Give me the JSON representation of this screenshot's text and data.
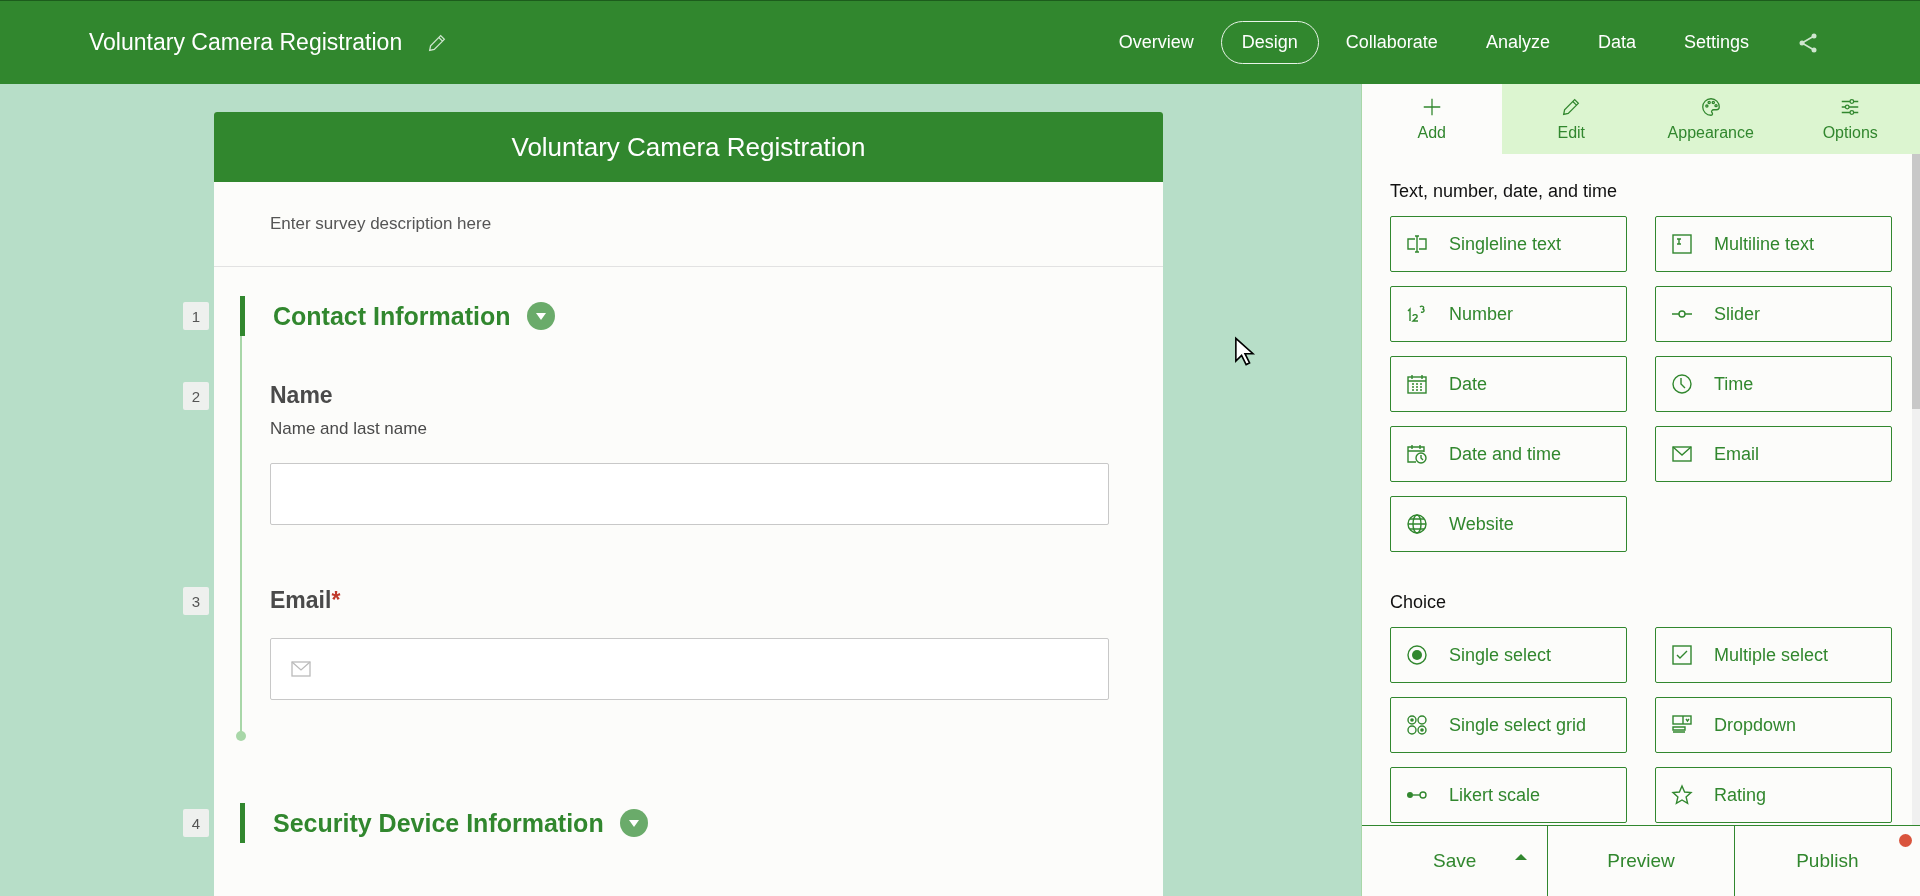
{
  "header": {
    "title": "Voluntary Camera Registration",
    "nav": [
      {
        "label": "Overview",
        "selected": false
      },
      {
        "label": "Design",
        "selected": true
      },
      {
        "label": "Collaborate",
        "selected": false
      },
      {
        "label": "Analyze",
        "selected": false
      },
      {
        "label": "Data",
        "selected": false
      },
      {
        "label": "Settings",
        "selected": false
      }
    ]
  },
  "survey": {
    "title": "Voluntary Camera Registration",
    "description": "Enter survey description here",
    "sections": [
      {
        "number": "1",
        "title": "Contact Information",
        "questions": [
          {
            "number": "2",
            "label": "Name",
            "hint": "Name and last name",
            "kind": "text"
          },
          {
            "number": "3",
            "label": "Email",
            "required_mark": "*",
            "kind": "email"
          }
        ]
      },
      {
        "number": "4",
        "title": "Security Device Information"
      }
    ]
  },
  "panel": {
    "tabs": [
      {
        "label": "Add",
        "kind": "plus",
        "selected": true
      },
      {
        "label": "Edit",
        "kind": "pencil",
        "selected": false
      },
      {
        "label": "Appearance",
        "kind": "palette",
        "selected": false
      },
      {
        "label": "Options",
        "kind": "sliders",
        "selected": false
      }
    ],
    "groups": [
      {
        "title": "Text, number, date, and time",
        "items": [
          {
            "label": "Singleline text",
            "kind": "singleline"
          },
          {
            "label": "Multiline text",
            "kind": "multiline"
          },
          {
            "label": "Number",
            "kind": "number"
          },
          {
            "label": "Slider",
            "kind": "slider"
          },
          {
            "label": "Date",
            "kind": "date"
          },
          {
            "label": "Time",
            "kind": "time"
          },
          {
            "label": "Date and time",
            "kind": "datetime"
          },
          {
            "label": "Email",
            "kind": "email"
          },
          {
            "label": "Website",
            "kind": "website"
          }
        ]
      },
      {
        "title": "Choice",
        "items": [
          {
            "label": "Single select",
            "kind": "radio"
          },
          {
            "label": "Multiple select",
            "kind": "checkbox"
          },
          {
            "label": "Single select grid",
            "kind": "grid"
          },
          {
            "label": "Dropdown",
            "kind": "dropdown"
          },
          {
            "label": "Likert scale",
            "kind": "likert"
          },
          {
            "label": "Rating",
            "kind": "star"
          }
        ]
      }
    ]
  },
  "footer": {
    "buttons": [
      {
        "label": "Save",
        "kind": "split"
      },
      {
        "label": "Preview",
        "kind": "plain"
      },
      {
        "label": "Publish",
        "kind": "notify"
      }
    ]
  }
}
